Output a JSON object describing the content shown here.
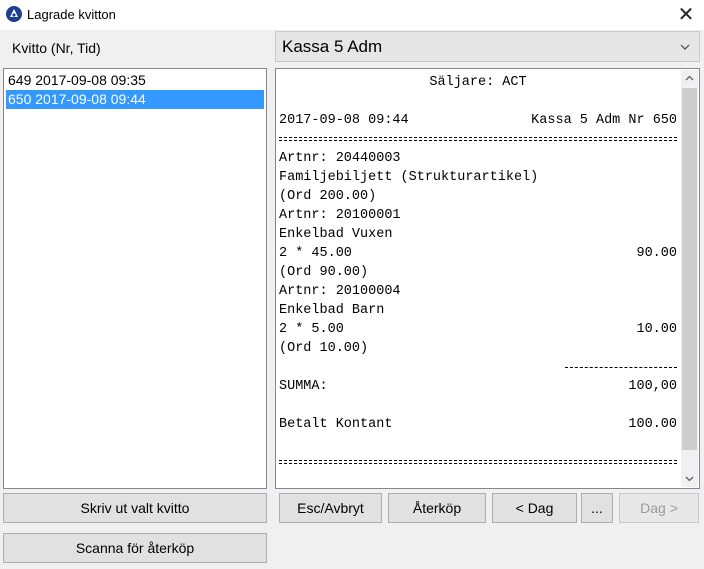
{
  "window": {
    "title": "Lagrade kvitton",
    "close_glyph": "✕"
  },
  "left": {
    "header": "Kvitto (Nr, Tid)",
    "items": [
      {
        "label": "649 2017-09-08 09:35",
        "selected": false
      },
      {
        "label": "650 2017-09-08 09:44",
        "selected": true
      }
    ],
    "print_button": "Skriv ut valt kvitto",
    "scan_button": "Scanna för återköp"
  },
  "kassa_select": {
    "value": "Kassa 5 Adm"
  },
  "receipt": {
    "seller": "Säljare: ACT",
    "datetime": "2017-09-08 09:44",
    "register": "Kassa 5 Adm Nr 650",
    "lines": [
      {
        "left": "Artnr: 20440003",
        "right": ""
      },
      {
        "left": "Familjebiljett (Strukturartikel)",
        "right": ""
      },
      {
        "left": "(Ord 200.00)",
        "right": ""
      },
      {
        "left": "Artnr: 20100001",
        "right": ""
      },
      {
        "left": "Enkelbad Vuxen",
        "right": ""
      },
      {
        "left": "2 * 45.00",
        "right": "90.00"
      },
      {
        "left": "(Ord 90.00)",
        "right": ""
      },
      {
        "left": "Artnr: 20100004",
        "right": ""
      },
      {
        "left": "Enkelbad Barn",
        "right": ""
      },
      {
        "left": "2 * 5.00",
        "right": "10.00"
      },
      {
        "left": "(Ord 10.00)",
        "right": ""
      }
    ],
    "sum_label": "SUMMA:",
    "sum_value": "100,00",
    "paid_label": "Betalt Kontant",
    "paid_value": "100.00"
  },
  "buttons": {
    "esc": "Esc/Avbryt",
    "aterkop": "Återköp",
    "prev_day": "< Dag",
    "more": "...",
    "next_day": "Dag >"
  },
  "icons": {
    "app": "app-logo-icon",
    "close": "close-icon",
    "chevron": "chevron-down-icon",
    "scroll_up": "scroll-up-icon",
    "scroll_down": "scroll-down-icon"
  }
}
